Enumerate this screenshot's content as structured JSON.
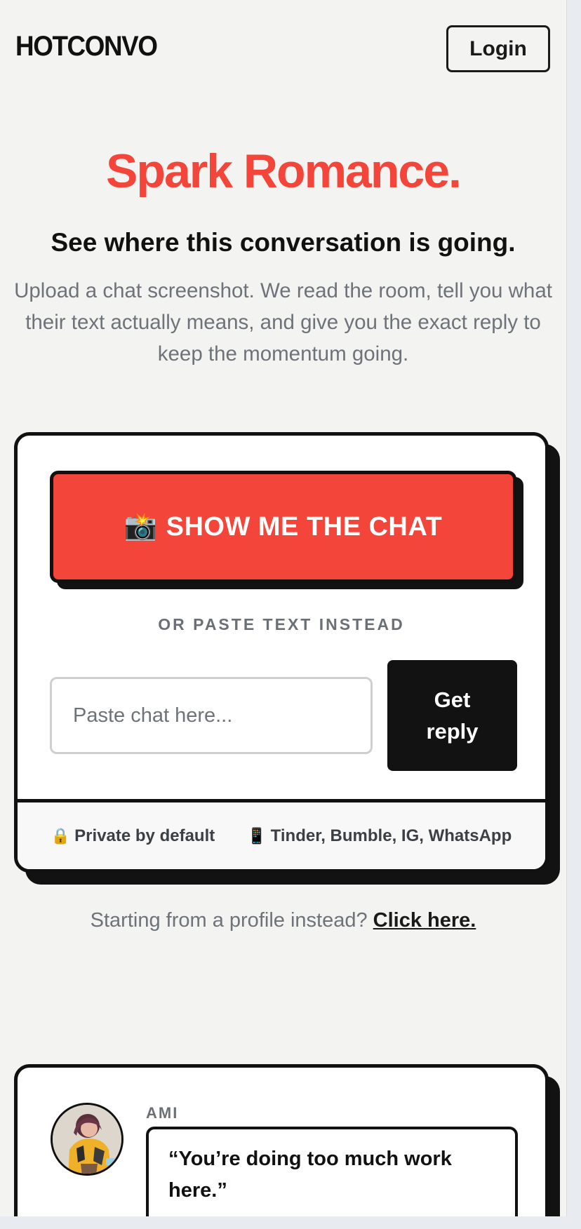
{
  "header": {
    "logo": "HOTCONVO",
    "login_label": "Login"
  },
  "hero": {
    "title": "Spark Romance.",
    "subtitle": "See where this conversation is going.",
    "description": "Upload a chat screenshot. We read the room, tell you what their text actually means, and give you the exact reply to keep the momentum going."
  },
  "upload_card": {
    "upload_button_emoji": "📸",
    "upload_button_label": "SHOW ME THE CHAT",
    "divider_text": "OR PASTE TEXT INSTEAD",
    "input_placeholder": "Paste chat here...",
    "input_value": "",
    "submit_label": "Get reply",
    "features": [
      {
        "icon": "lock-icon",
        "glyph": "🔒",
        "label": "Private by default"
      },
      {
        "icon": "phone-icon",
        "glyph": "📱",
        "label": "Tinder, Bumble, IG, WhatsApp"
      }
    ]
  },
  "profile_prompt": {
    "text": "Starting from a profile instead?",
    "link_label": "Click here."
  },
  "testimonial": {
    "name": "AMI",
    "quote": "“You’re doing too much work here.”"
  },
  "colors": {
    "accent": "#f4453a",
    "ink": "#111111",
    "background": "#f3f3f2",
    "muted": "#6e7279"
  }
}
